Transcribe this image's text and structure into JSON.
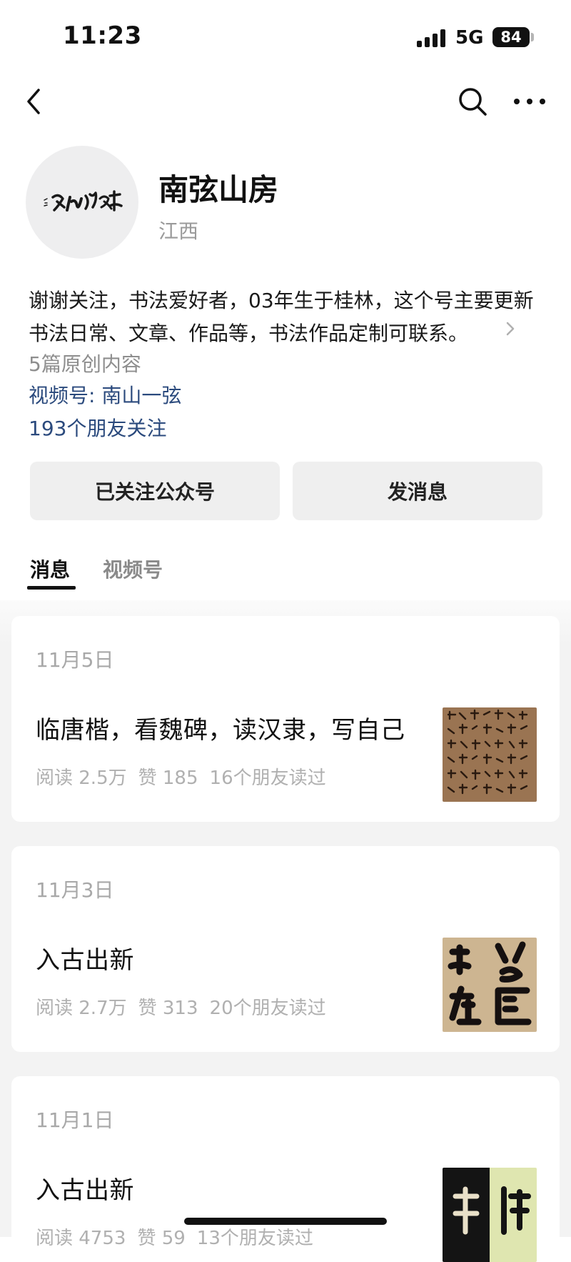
{
  "status_bar": {
    "time": "11:23",
    "network": "5G",
    "battery": "84"
  },
  "nav": {
    "icons": [
      "back-icon",
      "search-icon",
      "more-icon"
    ]
  },
  "profile": {
    "name": "南弦山房",
    "region": "江西",
    "description": "谢谢关注，书法爱好者，03年生于桂林，这个号主要更新书法日常、文章、作品等，书法作品定制可联系。",
    "original_count": "5篇原创内容",
    "video_channel": "视频号: 南山一弦",
    "friends_following": "193个朋友关注"
  },
  "actions": {
    "followed_label": "已关注公众号",
    "message_label": "发消息"
  },
  "tabs": [
    {
      "label": "消息",
      "active": true
    },
    {
      "label": "视频号",
      "active": false
    }
  ],
  "articles": [
    {
      "date": "11月5日",
      "title": "临唐楷，看魏碑，读汉隶，写自己",
      "reads": "阅读 2.5万",
      "likes": "赞 185",
      "friends_read": "16个朋友读过"
    },
    {
      "date": "11月3日",
      "title": "入古出新",
      "reads": "阅读 2.7万",
      "likes": "赞 313",
      "friends_read": "20个朋友读过"
    },
    {
      "date": "11月1日",
      "title": "入古出新",
      "reads": "阅读 4753",
      "likes": "赞 59",
      "friends_read": "13个朋友读过"
    }
  ],
  "colors": {
    "link": "#2b4a7d",
    "button_bg": "#efefef",
    "muted_text": "#a8a8a8"
  }
}
